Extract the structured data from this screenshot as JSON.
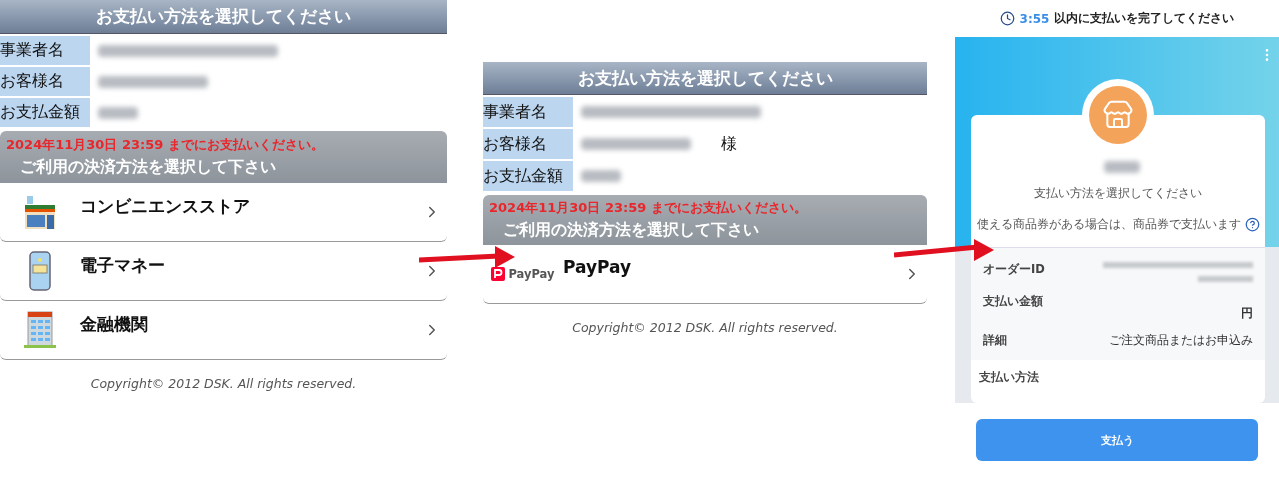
{
  "screens": [
    {
      "kind": "methods",
      "title": "お支払い方法を選択してください",
      "info_rows": [
        {
          "label": "事業者名"
        },
        {
          "label": "お客様名"
        },
        {
          "label": "お支払金額"
        }
      ],
      "deadline": "2024年11月30日 23:59 までにお支払いください。",
      "subtitle": "ご利用の決済方法を選択して下さい",
      "methods": [
        {
          "kind": "store",
          "label": "コンビニエンスストア"
        },
        {
          "kind": "phone",
          "label": "電子マネー"
        },
        {
          "kind": "bank",
          "label": "金融機関"
        }
      ],
      "copyright": "Copyright© 2012 DSK. All rights reserved."
    },
    {
      "kind": "methods",
      "title": "お支払い方法を選択してください",
      "info_rows": [
        {
          "label": "事業者名"
        },
        {
          "label": "お客様名",
          "suffix": "様"
        },
        {
          "label": "お支払金額"
        }
      ],
      "deadline": "2024年11月30日 23:59 までにお支払いください。",
      "subtitle": "ご利用の決済方法を選択して下さい",
      "methods": [
        {
          "kind": "paypay",
          "logo_text": "PayPay",
          "label": "PayPay"
        }
      ],
      "copyright": "Copyright© 2012 DSK. All rights reserved."
    },
    {
      "kind": "checkout",
      "timer": {
        "time": "3:55",
        "text": "以内に支払いを完了してください"
      },
      "prompt": "支払い方法を選択してください",
      "voucher_note": "使える商品券がある場合は、商品券で支払います",
      "details": [
        {
          "label": "オーダーID"
        },
        {
          "label": "支払い金額",
          "value": "円"
        },
        {
          "label": "詳細",
          "value": "ご注文商品またはお申込み"
        }
      ],
      "section_title": "支払い方法",
      "button": "支払う"
    }
  ]
}
